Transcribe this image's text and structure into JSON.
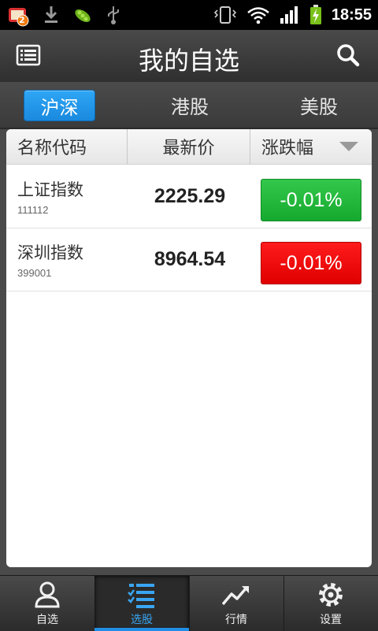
{
  "status_bar": {
    "notification_badge": "2",
    "time": "18:55",
    "icons": [
      "app-notification-icon",
      "download-icon",
      "pea-app-icon",
      "usb-icon",
      "vibrate-icon",
      "wifi-icon",
      "signal-icon",
      "battery-charging-icon"
    ]
  },
  "header": {
    "title": "我的自选",
    "left_icon": "list-icon",
    "right_icon": "search-icon"
  },
  "market_tabs": [
    {
      "label": "沪深",
      "active": true
    },
    {
      "label": "港股",
      "active": false
    },
    {
      "label": "美股",
      "active": false
    }
  ],
  "table": {
    "columns": [
      "名称代码",
      "最新价",
      "涨跌幅"
    ],
    "sort_icon": "triangle-down-icon",
    "rows": [
      {
        "name": "上证指数",
        "code": "111112",
        "price": "2225.29",
        "change": "-0.01%",
        "change_color": "#1fb535"
      },
      {
        "name": "深圳指数",
        "code": "399001",
        "price": "8964.54",
        "change": "-0.01%",
        "change_color": "#ee0000"
      }
    ]
  },
  "bottom_nav": [
    {
      "label": "自选",
      "icon": "person-icon",
      "active": false
    },
    {
      "label": "选股",
      "icon": "checklist-icon",
      "active": true
    },
    {
      "label": "行情",
      "icon": "trend-icon",
      "active": false
    },
    {
      "label": "设置",
      "icon": "gear-icon",
      "active": false
    }
  ],
  "colors": {
    "accent": "#1f8fe6",
    "up": "#1fb535",
    "down": "#ee0000"
  }
}
